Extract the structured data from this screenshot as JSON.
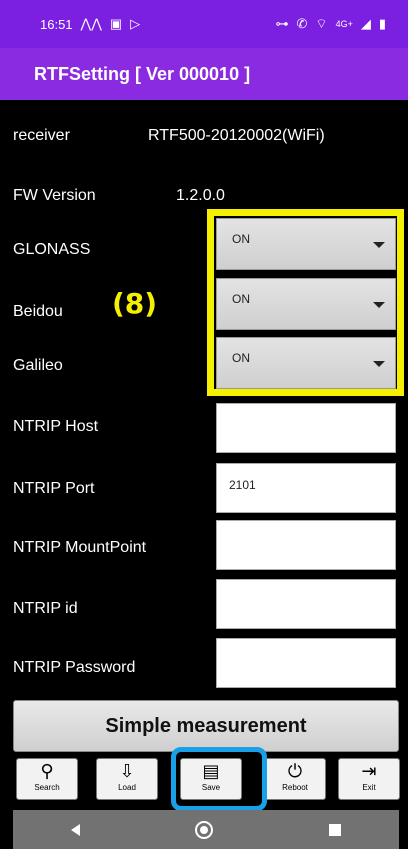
{
  "status_bar": {
    "time": "16:51",
    "left_icons": [
      "chart-icon",
      "image-icon",
      "cast-icon"
    ],
    "right_text": "4G+",
    "right_icons": [
      "vpn-icon",
      "call-icon",
      "wifi-icon",
      "signal-icon",
      "battery-icon"
    ]
  },
  "app_bar": {
    "title": "RTFSetting  [ Ver 000010 ]"
  },
  "rows": {
    "receiver": {
      "label": "receiver",
      "value": "RTF500-20120002(WiFi)"
    },
    "fw_version": {
      "label": "FW Version",
      "value": "1.2.0.0"
    },
    "glonass": {
      "label": "GLONASS",
      "value": "ON"
    },
    "beidou": {
      "label": "Beidou",
      "value": "ON"
    },
    "galileo": {
      "label": "Galileo",
      "value": "ON"
    },
    "ntrip_host": {
      "label": "NTRIP Host",
      "value": ""
    },
    "ntrip_port": {
      "label": "NTRIP Port",
      "value": "2101"
    },
    "ntrip_mountpoint": {
      "label": "NTRIP MountPoint",
      "value": ""
    },
    "ntrip_id": {
      "label": "NTRIP id",
      "value": ""
    },
    "ntrip_password": {
      "label": "NTRIP Password",
      "value": ""
    }
  },
  "annotation": {
    "label": "(8)",
    "color": "#f5f000"
  },
  "simple_measurement_label": "Simple measurement",
  "toolbar": {
    "search": "Search",
    "load": "Load",
    "save": "Save",
    "reboot": "Reboot",
    "exit": "Exit"
  },
  "colors": {
    "status_bar": "#7b1fe0",
    "app_bar": "#8a2be2",
    "highlight": "#f5f000",
    "save_highlight": "#1aa0e8"
  }
}
